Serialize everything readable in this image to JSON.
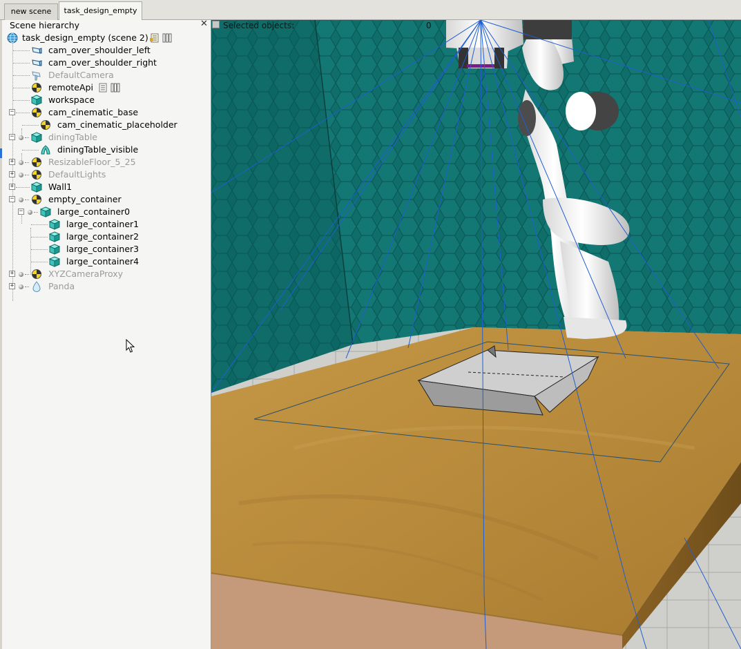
{
  "tabs": [
    {
      "label": "new scene",
      "active": false
    },
    {
      "label": "task_design_empty",
      "active": true
    }
  ],
  "hierarchy": {
    "title": "Scene hierarchy",
    "close_icon": "close-icon",
    "items": [
      {
        "label": "task_design_empty (scene 2)",
        "icon": "globe-icon",
        "dim": false
      },
      {
        "label": "cam_over_shoulder_left",
        "icon": "camera-icon",
        "dim": false
      },
      {
        "label": "cam_over_shoulder_right",
        "icon": "camera-icon",
        "dim": false
      },
      {
        "label": "DefaultCamera",
        "icon": "camera-icon",
        "dim": true
      },
      {
        "label": "remoteApi",
        "icon": "dummy-icon",
        "dim": false
      },
      {
        "label": "workspace",
        "icon": "cuboid-icon",
        "dim": false
      },
      {
        "label": "cam_cinematic_base",
        "icon": "dummy-icon",
        "dim": false
      },
      {
        "label": "cam_cinematic_placeholder",
        "icon": "dummy-icon",
        "dim": false
      },
      {
        "label": "diningTable",
        "icon": "cuboid-icon",
        "dim": true
      },
      {
        "label": "diningTable_visible",
        "icon": "shape-icon",
        "dim": false
      },
      {
        "label": "ResizableFloor_5_25",
        "icon": "dummy-icon",
        "dim": true
      },
      {
        "label": "DefaultLights",
        "icon": "dummy-icon",
        "dim": true
      },
      {
        "label": "Wall1",
        "icon": "cuboid-icon",
        "dim": false
      },
      {
        "label": "empty_container",
        "icon": "dummy-icon",
        "dim": false
      },
      {
        "label": "large_container0",
        "icon": "cuboid-icon",
        "dim": false
      },
      {
        "label": "large_container1",
        "icon": "cuboid-icon",
        "dim": false
      },
      {
        "label": "large_container2",
        "icon": "cuboid-icon",
        "dim": false
      },
      {
        "label": "large_container3",
        "icon": "cuboid-icon",
        "dim": false
      },
      {
        "label": "large_container4",
        "icon": "cuboid-icon",
        "dim": false
      },
      {
        "label": "XYZCameraProxy",
        "icon": "dummy-icon",
        "dim": true
      },
      {
        "label": "Panda",
        "icon": "joint-icon",
        "dim": true
      }
    ]
  },
  "scene": {
    "selected_label": "Selected objects:",
    "selected_count": "0"
  },
  "colors": {
    "wall": "#0e6e6a",
    "table": "#b9893b",
    "floor": "#c9c9c6",
    "ray": "#1f5fd0"
  }
}
